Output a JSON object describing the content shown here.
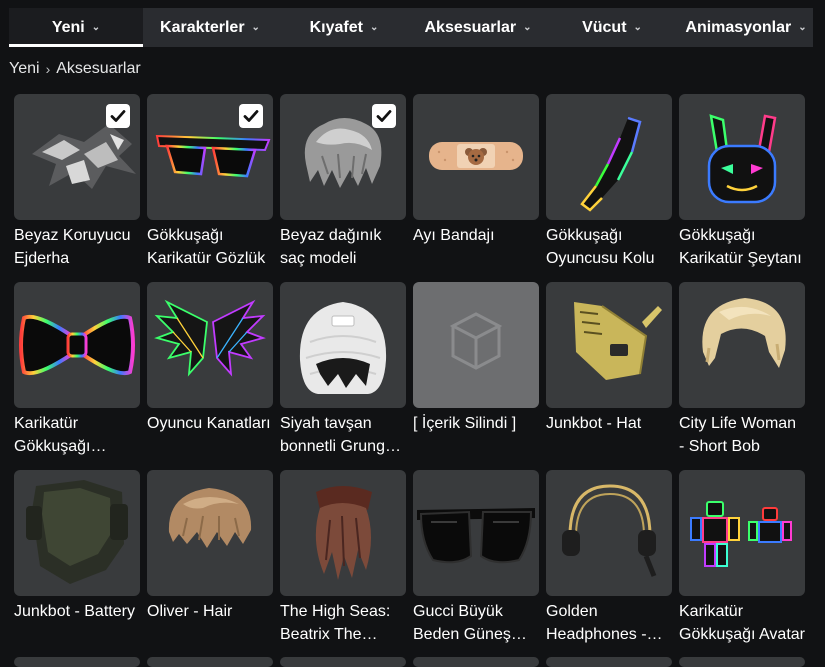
{
  "nav": {
    "tabs": [
      {
        "label": "Yeni",
        "active": true
      },
      {
        "label": "Karakterler",
        "active": false
      },
      {
        "label": "Kıyafet",
        "active": false
      },
      {
        "label": "Aksesuarlar",
        "active": false
      },
      {
        "label": "Vücut",
        "active": false
      },
      {
        "label": "Animasyonlar",
        "active": false
      }
    ]
  },
  "breadcrumb": {
    "root": "Yeni",
    "current": "Aksesuarlar"
  },
  "items": [
    {
      "name": "Beyaz Koruyucu Ejderha",
      "checked": true,
      "icon": "dragon-icon"
    },
    {
      "name": "Gökkuşağı Karikatür Gözlük",
      "checked": true,
      "icon": "glasses-icon"
    },
    {
      "name": "Beyaz dağınık saç modeli",
      "checked": true,
      "icon": "hair-icon"
    },
    {
      "name": "Ayı Bandajı",
      "checked": false,
      "icon": "bandage-icon"
    },
    {
      "name": "Gökkuşağı Oyuncusu Kolu",
      "checked": false,
      "icon": "arm-icon"
    },
    {
      "name": "Gökkuşağı Karikatür Şeytanı",
      "checked": false,
      "icon": "bunny-head-icon"
    },
    {
      "name": "Karikatür Gökkuşağı Papyon",
      "checked": false,
      "icon": "bowtie-icon"
    },
    {
      "name": "Oyuncu Kanatları",
      "checked": false,
      "icon": "wings-icon"
    },
    {
      "name": "Siyah tavşan bonnetli Grunge Saç",
      "checked": false,
      "icon": "bonnet-icon"
    },
    {
      "name": "[ İçerik Silindi ]",
      "checked": false,
      "icon": "deleted-content-icon"
    },
    {
      "name": "Junkbot - Hat",
      "checked": false,
      "icon": "robot-hat-icon"
    },
    {
      "name": "City Life Woman - Short Bob",
      "checked": false,
      "icon": "blonde-hair-icon"
    },
    {
      "name": "Junkbot - Battery",
      "checked": false,
      "icon": "battery-icon"
    },
    {
      "name": "Oliver - Hair",
      "checked": false,
      "icon": "brown-hair-icon"
    },
    {
      "name": "The High Seas: Beatrix The Pirate",
      "checked": false,
      "icon": "pirate-hair-icon"
    },
    {
      "name": "Gucci Büyük Beden Güneş Gözlüğü",
      "checked": false,
      "icon": "sunglasses-icon"
    },
    {
      "name": "Golden Headphones - Gold",
      "checked": false,
      "icon": "headphones-icon"
    },
    {
      "name": "Karikatür Gökkuşağı Avatar",
      "checked": false,
      "icon": "avatar-figures-icon"
    }
  ]
}
